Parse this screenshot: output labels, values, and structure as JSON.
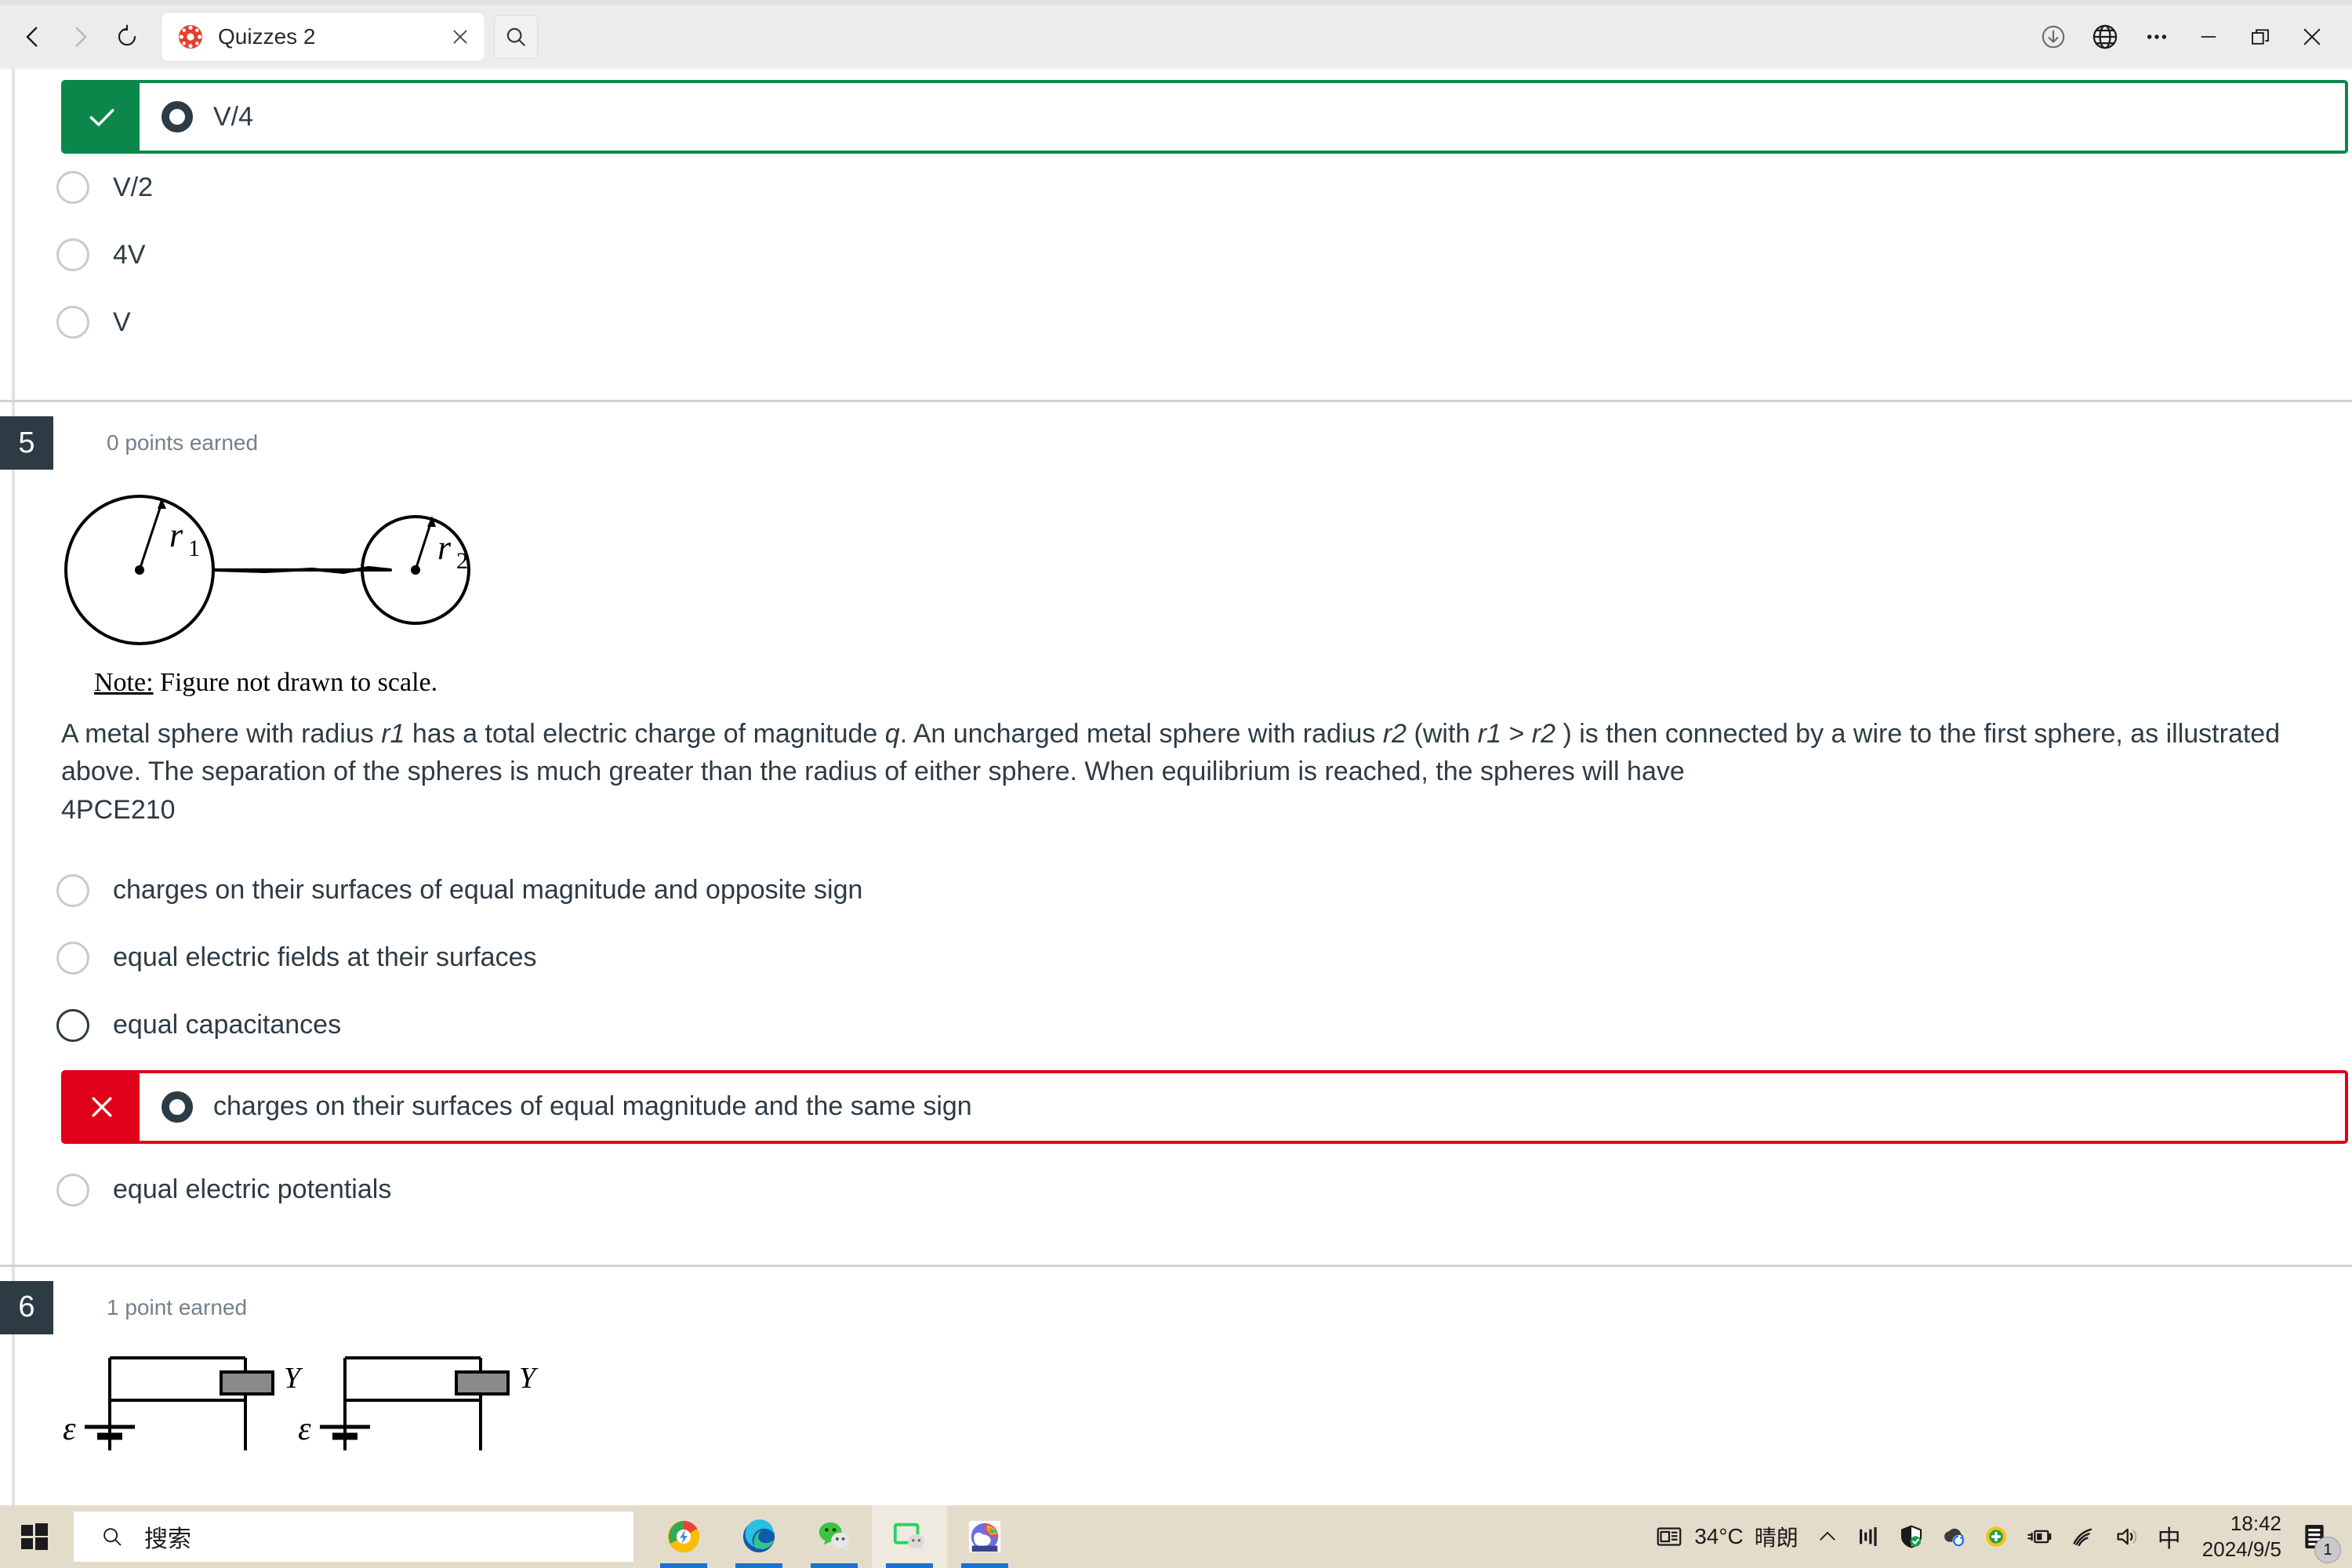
{
  "browser": {
    "nav": {
      "back": "back-arrow",
      "forward": "forward-arrow",
      "reload": "reload"
    },
    "tab": {
      "title": "Quizzes 2",
      "favicon": "canvas-lms-icon",
      "close": "close-tab"
    },
    "tab_search_label": "search-tabs",
    "right_buttons": [
      "downloads",
      "translate",
      "more-options",
      "minimize",
      "restore",
      "close"
    ]
  },
  "quiz": {
    "question4_options": [
      {
        "label": "V/4",
        "state": "correct-selected",
        "mark": "✓"
      },
      {
        "label": "V/2",
        "state": "unselected"
      },
      {
        "label": "4V",
        "state": "unselected"
      },
      {
        "label": "V",
        "state": "unselected"
      }
    ],
    "question5": {
      "number": "5",
      "points": "0 points earned",
      "figure": {
        "label_r1": "r",
        "sub_r1": "1",
        "label_r2": "r",
        "sub_r2": "2",
        "note_prefix": "Note:",
        "note_text": " Figure not drawn to scale."
      },
      "text_line1_a": "A metal sphere with radius ",
      "text_line1_r1": "r1",
      "text_line1_b": " has a total electric charge of magnitude ",
      "text_line1_q": "q",
      "text_line1_c": ". An uncharged metal sphere with radius ",
      "text_line1_r2": "r2",
      "text_line1_d": " (with ",
      "text_line1_r1b": "r1",
      "text_line1_e": " > ",
      "text_line1_r2b": "r2",
      "text_line1_f": " ) is then connected by a wire to the first sphere, as illustrated above. The separation of the spheres is much greater than the radius of either sphere. When equilibrium is reached, the spheres will have",
      "code": "4PCE210",
      "options": [
        {
          "label": "charges on their surfaces of equal magnitude and opposite sign",
          "state": "unselected"
        },
        {
          "label": "equal electric fields at their surfaces",
          "state": "unselected"
        },
        {
          "label": "equal capacitances",
          "state": "hover"
        },
        {
          "label": "charges on their surfaces of equal magnitude and the same sign",
          "state": "incorrect-selected",
          "mark": "✕"
        },
        {
          "label": "equal electric potentials",
          "state": "unselected"
        }
      ]
    },
    "question6": {
      "number": "6",
      "points": "1 point earned",
      "figure": {
        "emf_symbol": "ε",
        "component_label": "Y"
      }
    }
  },
  "taskbar": {
    "start": "windows-start",
    "search_placeholder": "搜索",
    "apps": [
      {
        "name": "chrome-canary-icon",
        "active": false
      },
      {
        "name": "edge-icon",
        "active": false
      },
      {
        "name": "wechat-icon",
        "active": false
      },
      {
        "name": "wechat-devtools-icon",
        "active": true
      },
      {
        "name": "weather-cloud-icon",
        "active": false
      }
    ],
    "weather_temp": "34°C",
    "weather_desc": "晴朗",
    "tray_icons": [
      "chevron-up-icon",
      "network-monitor-icon",
      "security-shield-icon",
      "onedrive-sync-icon",
      "update-icon",
      "battery-plug-icon",
      "wifi-icon",
      "volume-icon",
      "ime-chinese-icon"
    ],
    "ime_label": "中",
    "time": "18:42",
    "date": "2024/9/5",
    "notification_count": "1"
  },
  "colors": {
    "correct_green": "#0b874b",
    "incorrect_red": "#e00019",
    "text_dark": "#2d3b45",
    "muted": "#73818c",
    "taskbar_bg": "#e4dcca"
  }
}
